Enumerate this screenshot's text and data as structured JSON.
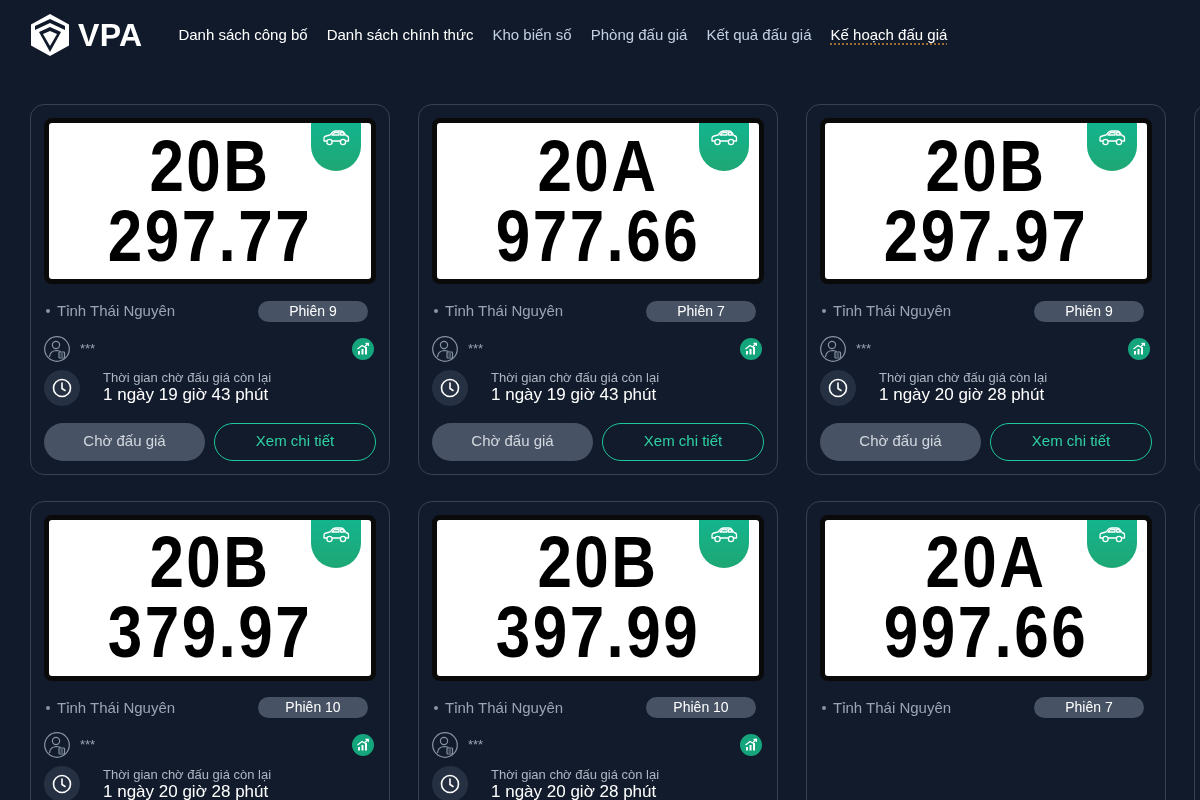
{
  "header": {
    "logo_text": "VPA",
    "nav": [
      {
        "label": "Danh sách công bố",
        "active": true,
        "underlined": false
      },
      {
        "label": "Danh sách chính thức",
        "active": true,
        "underlined": false
      },
      {
        "label": "Kho biển số",
        "active": false,
        "underlined": false
      },
      {
        "label": "Phòng đấu giá",
        "active": false,
        "underlined": false
      },
      {
        "label": "Kết quả đấu giá",
        "active": false,
        "underlined": false
      },
      {
        "label": "Kế hoạch đấu giá",
        "active": true,
        "underlined": true
      }
    ]
  },
  "card_rows": [
    {
      "cut_off_card": true,
      "cards": [
        {
          "plate": {
            "series": "20B",
            "number": "297.77"
          },
          "province": "Tỉnh Thái Nguyên",
          "session": "Phiên 9",
          "bidder": "***",
          "countdown_label": "Thời gian chờ đấu giá còn lại",
          "countdown": "1 ngày 19 giờ 43 phút",
          "status_button": "Chờ đấu giá",
          "detail_button": "Xem chi tiết"
        },
        {
          "plate": {
            "series": "20A",
            "number": "977.66"
          },
          "province": "Tỉnh Thái Nguyên",
          "session": "Phiên 7",
          "bidder": "***",
          "countdown_label": "Thời gian chờ đấu giá còn lại",
          "countdown": "1 ngày 19 giờ 43 phút",
          "status_button": "Chờ đấu giá",
          "detail_button": "Xem chi tiết"
        },
        {
          "plate": {
            "series": "20B",
            "number": "297.97"
          },
          "province": "Tỉnh Thái Nguyên",
          "session": "Phiên 9",
          "bidder": "***",
          "countdown_label": "Thời gian chờ đấu giá còn lại",
          "countdown": "1 ngày 20 giờ 28 phút",
          "status_button": "Chờ đấu giá",
          "detail_button": "Xem chi tiết"
        }
      ]
    },
    {
      "cut_off_card": true,
      "cards": [
        {
          "plate": {
            "series": "20B",
            "number": "379.97"
          },
          "province": "Tỉnh Thái Nguyên",
          "session": "Phiên 10",
          "bidder": "***",
          "countdown_label": "Thời gian chờ đấu giá còn lại",
          "countdown": "1 ngày 20 giờ 28 phút"
        },
        {
          "plate": {
            "series": "20B",
            "number": "397.99"
          },
          "province": "Tỉnh Thái Nguyên",
          "session": "Phiên 10",
          "bidder": "***",
          "countdown_label": "Thời gian chờ đấu giá còn lại",
          "countdown": "1 ngày 20 giờ 28 phút"
        },
        {
          "plate": {
            "series": "20A",
            "number": "997.66"
          },
          "province": "Tỉnh Thái Nguyên",
          "session": "Phiên 7"
        }
      ]
    }
  ]
}
